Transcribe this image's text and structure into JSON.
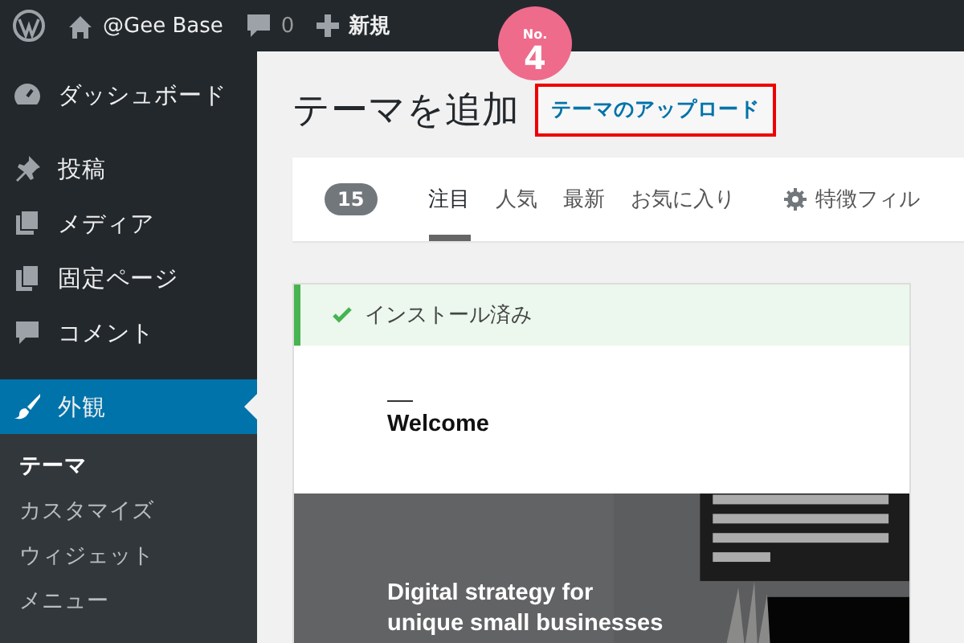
{
  "admin_bar": {
    "site_name": "@Gee Base",
    "comments": "0",
    "new_label": "新規"
  },
  "sidebar": {
    "items": [
      {
        "label": "ダッシュボード",
        "kind": "dashboard",
        "selected": false
      },
      {
        "label": "投稿",
        "kind": "posts",
        "selected": false
      },
      {
        "label": "メディア",
        "kind": "media",
        "selected": false
      },
      {
        "label": "固定ページ",
        "kind": "pages",
        "selected": false
      },
      {
        "label": "コメント",
        "kind": "comments",
        "selected": false
      },
      {
        "label": "外観",
        "kind": "appearance",
        "selected": true
      }
    ],
    "submenu": [
      {
        "label": "テーマ",
        "selected": true
      },
      {
        "label": "カスタマイズ",
        "selected": false
      },
      {
        "label": "ウィジェット",
        "selected": false
      },
      {
        "label": "メニュー",
        "selected": false
      }
    ]
  },
  "page": {
    "title": "テーマを追加",
    "upload_button": "テーマのアップロード",
    "step_badge": {
      "prefix": "No.",
      "number": "4"
    }
  },
  "filter_bar": {
    "count": "15",
    "tabs": [
      {
        "label": "注目",
        "selected": true
      },
      {
        "label": "人気",
        "selected": false
      },
      {
        "label": "最新",
        "selected": false
      },
      {
        "label": "お気に入り",
        "selected": false
      }
    ],
    "feature_filter": "特徴フィル"
  },
  "theme_card": {
    "installed_notice": "インストール済み",
    "preview": {
      "heading": "Welcome",
      "hero_lines": [
        "Digital strategy for",
        "unique small businesses"
      ]
    }
  }
}
